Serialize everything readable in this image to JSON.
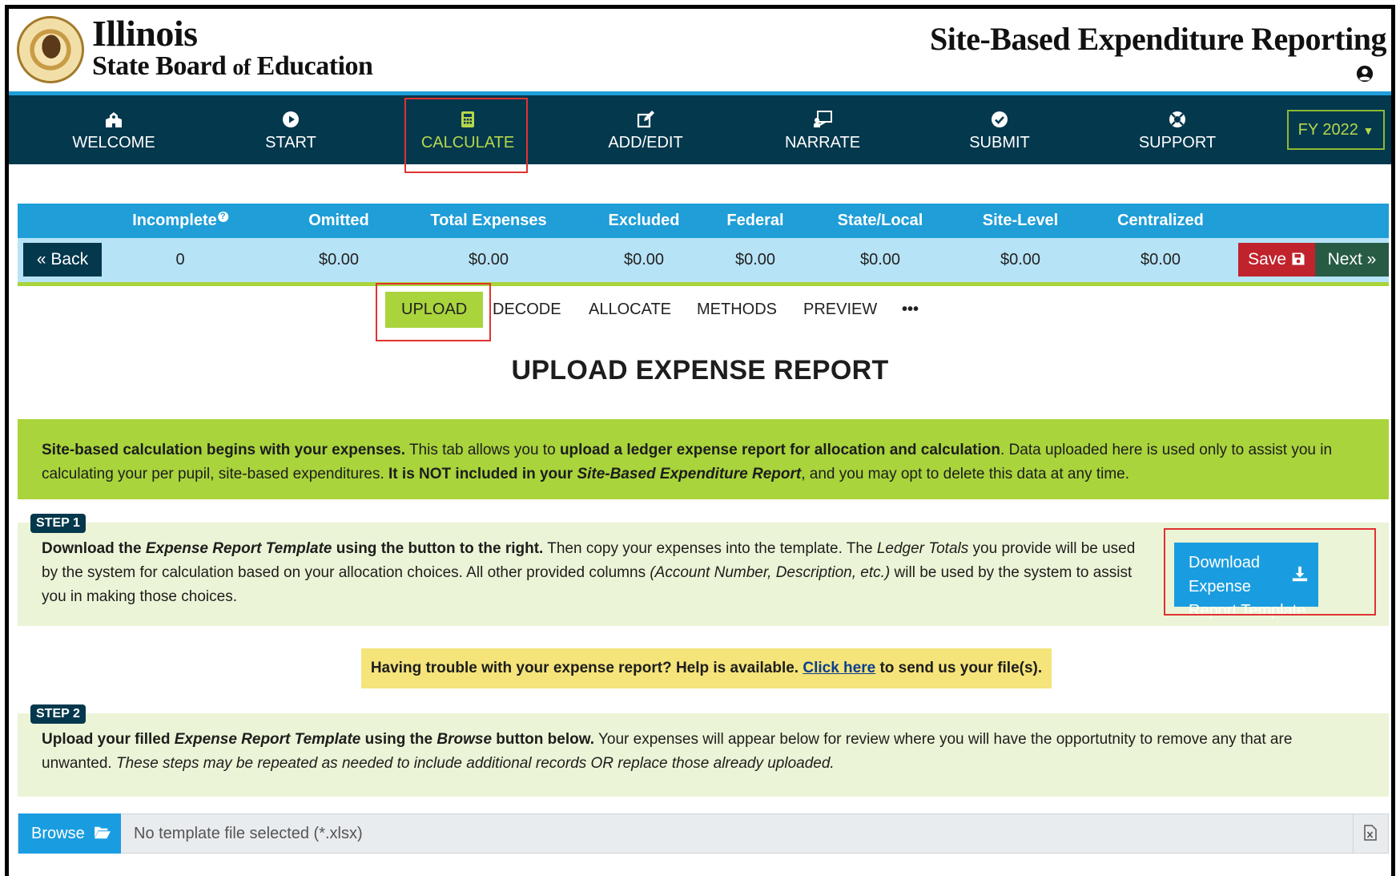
{
  "header": {
    "org_line1": "Illinois",
    "org_line2_a": "State Board ",
    "org_line2_of": "of",
    "org_line2_b": " Education",
    "app_title": "Site-Based Expenditure Reporting"
  },
  "nav": {
    "items": [
      {
        "label": "WELCOME",
        "icon": "school-icon"
      },
      {
        "label": "START",
        "icon": "play-circle-icon"
      },
      {
        "label": "CALCULATE",
        "icon": "calculator-icon"
      },
      {
        "label": "ADD/EDIT",
        "icon": "edit-icon"
      },
      {
        "label": "NARRATE",
        "icon": "presenter-icon"
      },
      {
        "label": "SUBMIT",
        "icon": "check-circle-icon"
      },
      {
        "label": "SUPPORT",
        "icon": "lifebuoy-icon"
      }
    ],
    "active": "CALCULATE",
    "fiscal_year": "FY 2022"
  },
  "stats": {
    "headers": [
      "Incomplete",
      "Omitted",
      "Total Expenses",
      "Excluded",
      "Federal",
      "State/Local",
      "Site-Level",
      "Centralized"
    ],
    "values": [
      "0",
      "$0.00",
      "$0.00",
      "$0.00",
      "$0.00",
      "$0.00",
      "$0.00",
      "$0.00"
    ],
    "help_glyph": "?",
    "back_label": "Back",
    "save_label": "Save",
    "next_label": "Next"
  },
  "subtabs": {
    "items": [
      "UPLOAD",
      "DECODE",
      "ALLOCATE",
      "METHODS",
      "PREVIEW"
    ],
    "more": "•••",
    "active": "UPLOAD"
  },
  "page_title": "UPLOAD EXPENSE REPORT",
  "intro": {
    "p1_bold": "Site-based calculation begins with your expenses.",
    "p2": " This tab allows you to ",
    "p3_bold": "upload a ledger expense report for allocation and calculation",
    "p4": ". Data uploaded here is used only to assist you in calculating your per pupil, site-based expenditures. ",
    "p5_bold": "It is NOT included in your ",
    "p6_bolditalic": "Site-Based Expenditure Report",
    "p7": ", and you may opt to delete this data at any time."
  },
  "step1": {
    "badge": "STEP 1",
    "a_bold": "Download the ",
    "b_bolditalic": "Expense Report Template",
    "c_bold": " using the button to the right.",
    "d": " Then copy your expenses into the template. The ",
    "e_italic": "Ledger Totals",
    "f": " you provide will be used by the system for calculation based on your allocation choices. All other provided columns ",
    "g_italic": "(Account Number, Description, etc.)",
    "h": " will be used by the system to assist you in making those choices.",
    "download_line1": "Download Expense",
    "download_line2": "Report Template"
  },
  "help_bar": {
    "pre": "Having trouble with your expense report? Help is available. ",
    "link": "Click here",
    "post": " to send us your file(s)."
  },
  "step2": {
    "badge": "STEP 2",
    "a_bold": "Upload your filled ",
    "b_bolditalic": "Expense Report Template",
    "c_bold": " using the ",
    "d_bolditalic": "Browse",
    "e_bold": " button below.",
    "f": " Your expenses will appear below for review where you will have the opportutnity to remove any that are unwanted. ",
    "g_italic": "These steps may be repeated as needed to include additional records OR replace those already uploaded."
  },
  "browse": {
    "button_label": "Browse",
    "file_placeholder": "No template file selected (*.xlsx)"
  },
  "colors": {
    "nav_bg": "#04384d",
    "accent_blue": "#1f9ed8",
    "accent_green": "#a9d43c",
    "save_red": "#c0232c",
    "next_green": "#275b44",
    "highlight_red": "#e03232"
  }
}
